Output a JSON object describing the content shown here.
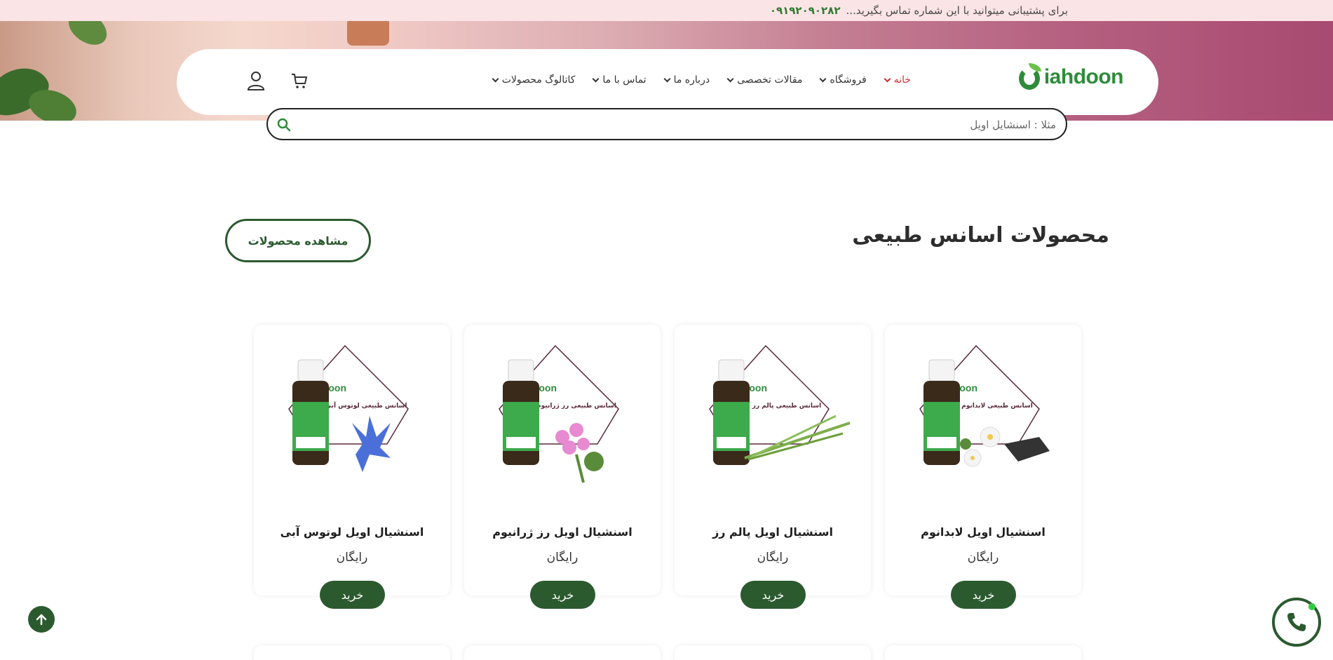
{
  "topbar": {
    "text": "برای پشتیبانی میتوانید با این شماره تماس بگیرید...",
    "phone": "۰۹۱۹۲۰۹۰۲۸۲"
  },
  "logo": {
    "word": "iahdoon"
  },
  "nav": {
    "items": [
      {
        "label": "خانه",
        "active": true
      },
      {
        "label": "فروشگاه"
      },
      {
        "label": "مقالات تخصصی"
      },
      {
        "label": "درباره ما"
      },
      {
        "label": "تماس با ما"
      },
      {
        "label": "کاتالوگ محصولات"
      }
    ]
  },
  "header_icons": [
    "cart-icon",
    "user-icon"
  ],
  "search": {
    "placeholder": "مثلا : اسنشایل اویل"
  },
  "section": {
    "title": "محصولات اسانس طبیعی",
    "view_button": "مشاهده محصولات"
  },
  "products": [
    {
      "name": "اسنشیال اویل لوتوس آبی",
      "price": "رایگان",
      "buy": "خرید",
      "flower_color": "#4a6fd8",
      "label_text": "اسانس طبیعی لوتوس آبی"
    },
    {
      "name": "اسنشیال اویل رز ژرانیوم",
      "price": "رایگان",
      "buy": "خرید",
      "flower_color": "#e78ad1",
      "label_text": "اسانس طبیعی رز ژرانیوم"
    },
    {
      "name": "اسنشیال اویل پالم رز",
      "price": "رایگان",
      "buy": "خرید",
      "flower_color": "#7cae4a",
      "label_text": "اسانس طبیعی پالم رز"
    },
    {
      "name": "اسنشیال اویل لابدانوم",
      "price": "رایگان",
      "buy": "خرید",
      "flower_color": "#f1f1f1",
      "label_text": "اسانس طبیعی لابدانوم"
    }
  ],
  "colors": {
    "primary_green": "#2b5a2f",
    "active_nav": "#d32f2f",
    "topbar_bg": "#fbe4e6"
  }
}
